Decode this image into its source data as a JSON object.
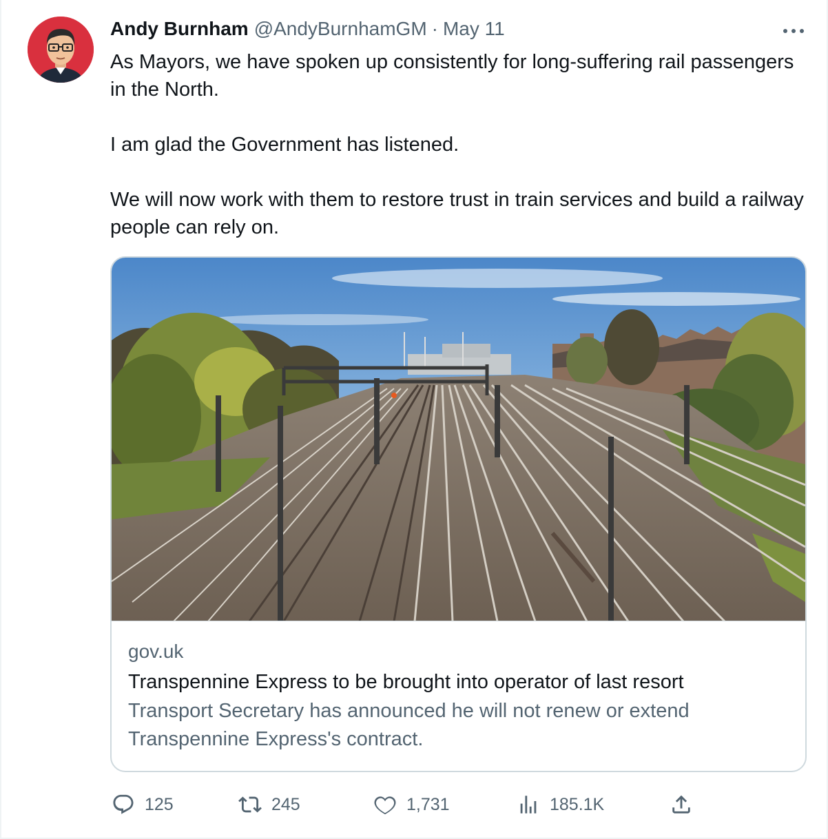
{
  "tweet": {
    "author_name": "Andy Burnham",
    "handle": "@AndyBurnhamGM",
    "separator": "·",
    "date": "May 11",
    "paragraphs": [
      "As Mayors, we have spoken up consistently for long-suffering rail passengers in the North.",
      "I am glad the Government has listened.",
      "We will now work with them to restore trust in train services and build a railway people can rely on."
    ],
    "more_icon": "more-horizontal-icon",
    "avatar_icon": "cartoon-portrait-avatar"
  },
  "card": {
    "image_icon": "railway-tracks-photo",
    "domain": "gov.uk",
    "title": "Transpennine Express to be brought into operator of last resort",
    "description": "Transport Secretary has announced he will not renew or extend Transpennine Express's contract."
  },
  "actions": {
    "reply": {
      "icon": "reply-bubble-icon",
      "count": "125"
    },
    "retweet": {
      "icon": "retweet-icon",
      "count": "245"
    },
    "like": {
      "icon": "heart-icon",
      "count": "1,731"
    },
    "views": {
      "icon": "analytics-bars-icon",
      "count": "185.1K"
    },
    "share": {
      "icon": "share-upload-icon"
    }
  },
  "colors": {
    "text_primary": "#0f1419",
    "text_secondary": "#536471",
    "border": "#cfd9de",
    "avatar_background": "#d9303e"
  }
}
